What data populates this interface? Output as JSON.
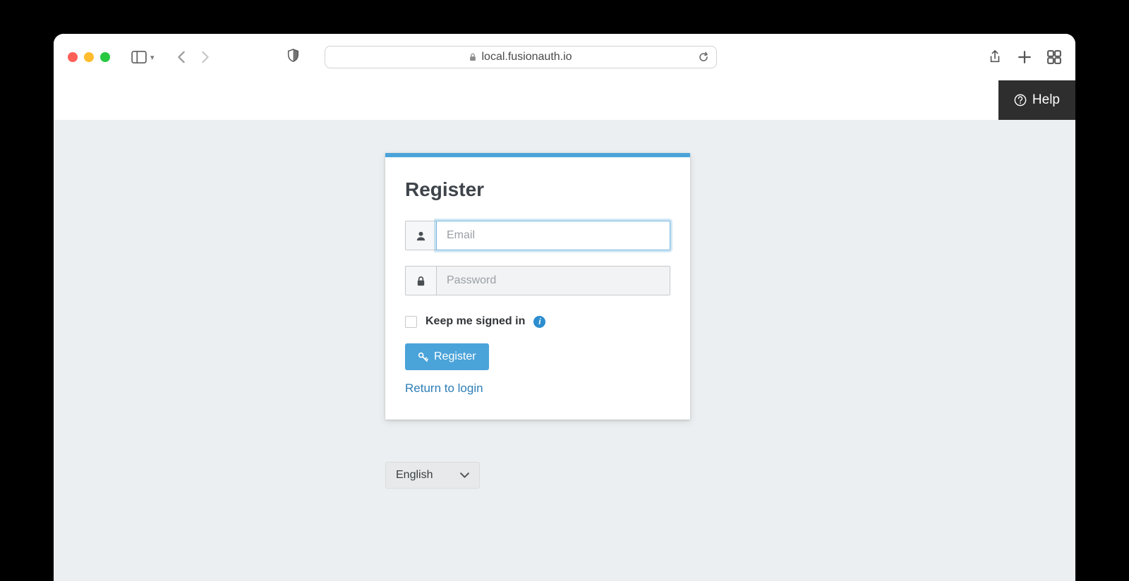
{
  "browser": {
    "url": "local.fusionauth.io"
  },
  "header": {
    "help_label": "Help"
  },
  "card": {
    "title": "Register",
    "email_placeholder": "Email",
    "password_placeholder": "Password",
    "keep_signed_in_label": "Keep me signed in",
    "info_glyph": "i",
    "register_button_label": "Register",
    "return_link_label": "Return to login"
  },
  "language": {
    "selected": "English"
  }
}
